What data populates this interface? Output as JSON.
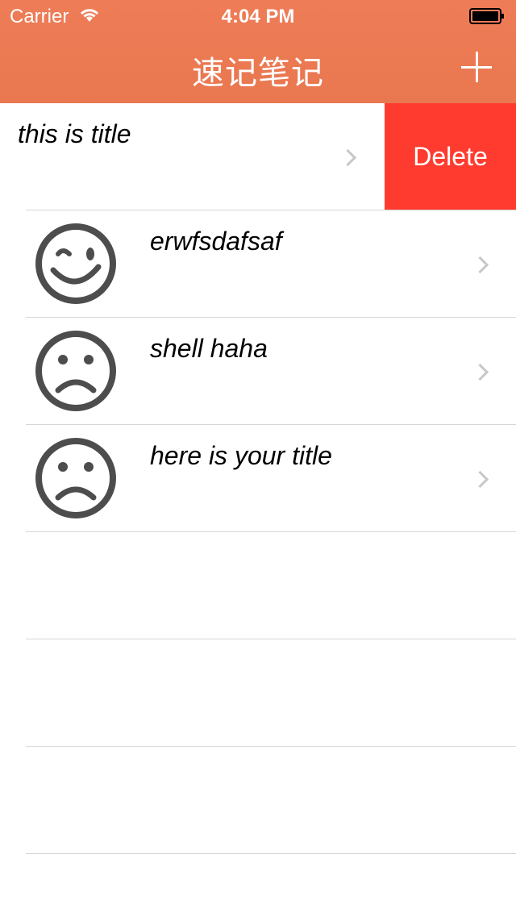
{
  "status_bar": {
    "carrier": "Carrier",
    "time": "4:04 PM"
  },
  "navbar": {
    "title": "速记笔记",
    "add_icon": "plus-icon"
  },
  "list": {
    "swiped_row": {
      "title": "this is title",
      "delete_label": "Delete"
    },
    "rows": [
      {
        "title": "erwfsdafsaf",
        "icon": "wink-face-icon"
      },
      {
        "title": "shell haha",
        "icon": "sad-face-icon"
      },
      {
        "title": "here is your title",
        "icon": "sad-face-icon"
      }
    ]
  },
  "colors": {
    "header": "#ed7a55",
    "delete": "#ff3b30",
    "separator": "#d6d6d6",
    "chevron": "#c7c7cc"
  }
}
